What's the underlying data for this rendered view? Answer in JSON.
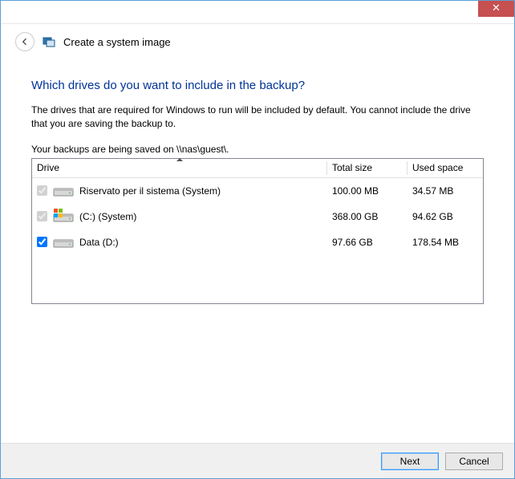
{
  "window": {
    "close_glyph": "✕"
  },
  "header": {
    "title": "Create a system image"
  },
  "main": {
    "heading": "Which drives do you want to include in the backup?",
    "description": "The drives that are required for Windows to run will be included by default. You cannot include the drive that you are saving the backup to.",
    "save_location_text": "Your backups are being saved on \\\\nas\\guest\\."
  },
  "table": {
    "columns": {
      "drive": "Drive",
      "total": "Total size",
      "used": "Used space"
    },
    "rows": [
      {
        "checked": true,
        "disabled": true,
        "system_badge": false,
        "label": "Riservato per il sistema (System)",
        "total": "100.00 MB",
        "used": "34.57 MB"
      },
      {
        "checked": true,
        "disabled": true,
        "system_badge": true,
        "label": "(C:) (System)",
        "total": "368.00 GB",
        "used": "94.62 GB"
      },
      {
        "checked": true,
        "disabled": false,
        "system_badge": false,
        "label": "Data (D:)",
        "total": "97.66 GB",
        "used": "178.54 MB"
      }
    ]
  },
  "footer": {
    "next": "Next",
    "cancel": "Cancel"
  }
}
